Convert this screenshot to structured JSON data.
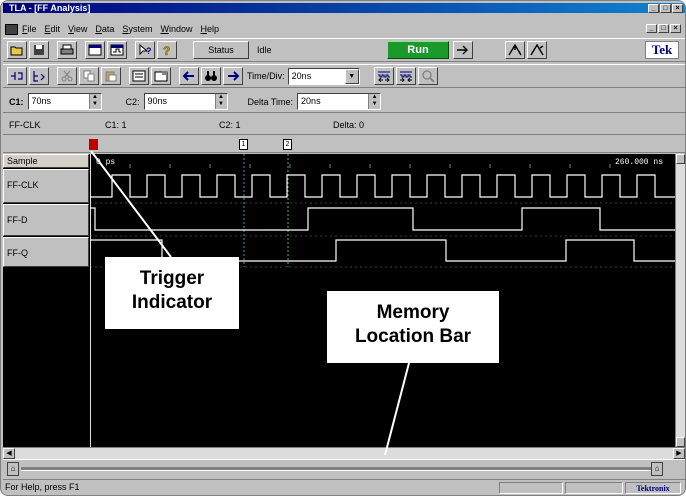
{
  "window": {
    "title": "TLA - [FF Analysis]",
    "buttons": [
      "_",
      "□",
      "×"
    ]
  },
  "menu": {
    "items": [
      "File",
      "Edit",
      "View",
      "Data",
      "System",
      "Window",
      "Help"
    ]
  },
  "toolbar1": {
    "status_label": "Status",
    "status_value": "Idle",
    "run_label": "Run",
    "logo": "Tek"
  },
  "toolbar2": {
    "timediv_label": "Time/Div:",
    "timediv_value": "20ns"
  },
  "cursors": {
    "c1_label": "C1:",
    "c1_value": "70ns",
    "c2_label": "C2:",
    "c2_value": "90ns",
    "delta_label": "Delta Time:",
    "delta_value": "20ns"
  },
  "info": {
    "signal": "FF-CLK",
    "c1": "C1: 1",
    "c2": "C2: 1",
    "delta": "Delta: 0"
  },
  "markers": {
    "c1": "1",
    "c2": "2"
  },
  "waveform": {
    "start_time": "0 ps",
    "end_time": "260.000 ns",
    "signals": [
      {
        "name": "Sample"
      },
      {
        "name": "FF-CLK"
      },
      {
        "name": "FF-D"
      },
      {
        "name": "FF-Q"
      }
    ]
  },
  "statusbar": {
    "help_text": "For Help, press F1",
    "brand": "Tektronix"
  },
  "callouts": {
    "trigger_line1": "Trigger",
    "trigger_line2": "Indicator",
    "memory_line1": "Memory",
    "memory_line2": "Location Bar"
  }
}
